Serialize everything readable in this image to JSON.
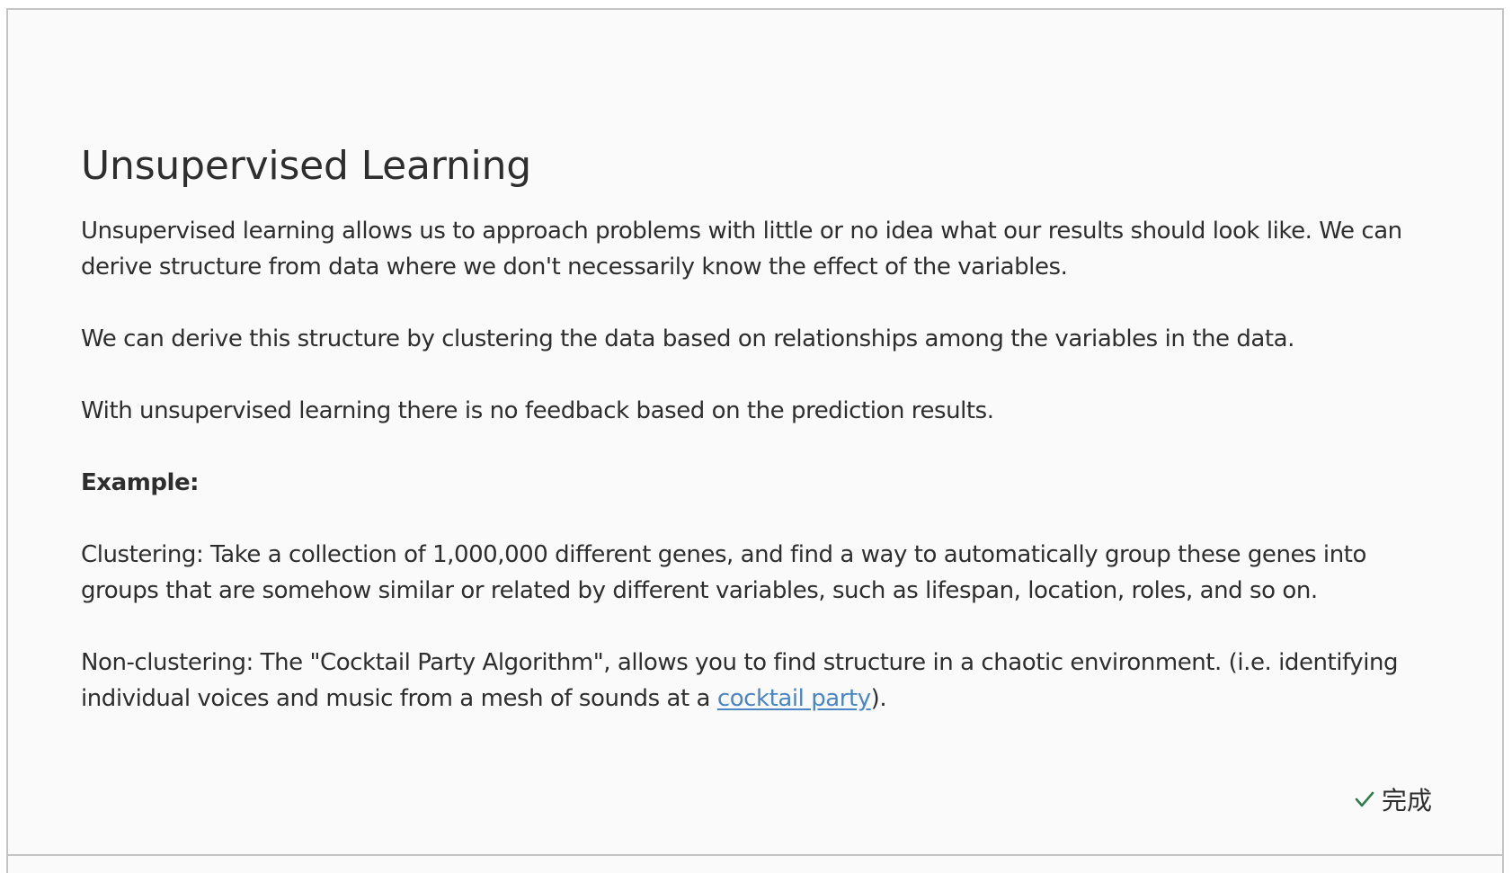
{
  "lesson": {
    "title": "Unsupervised Learning",
    "paragraph1": "Unsupervised learning allows us to approach problems with little or no idea what our results should look like. We can derive structure from data where we don't necessarily know the effect of the variables.",
    "paragraph2": "We can derive this structure by clustering the data based on relationships among the variables in the data.",
    "paragraph3": "With unsupervised learning there is no feedback based on the prediction results.",
    "example_heading": "Example:",
    "clustering_text": "Clustering: Take a collection of 1,000,000 different genes, and find a way to automatically group these genes into groups that are somehow similar or related by different variables, such as lifespan, location, roles, and so on.",
    "nonclustering_text_before": "Non-clustering: The \"Cocktail Party Algorithm\", allows you to find structure in a chaotic environment. (i.e. identifying individual voices and music from a mesh of sounds at a ",
    "nonclustering_link": "cocktail party",
    "nonclustering_text_after": ")."
  },
  "footer": {
    "done_label": "完成",
    "done_icon": "checkmark-icon",
    "done_icon_color": "#2e7d4f"
  },
  "colors": {
    "text": "#2e2e2e",
    "link": "#4a86c5",
    "card_background": "#fafafa",
    "border": "#c4c4c4"
  }
}
